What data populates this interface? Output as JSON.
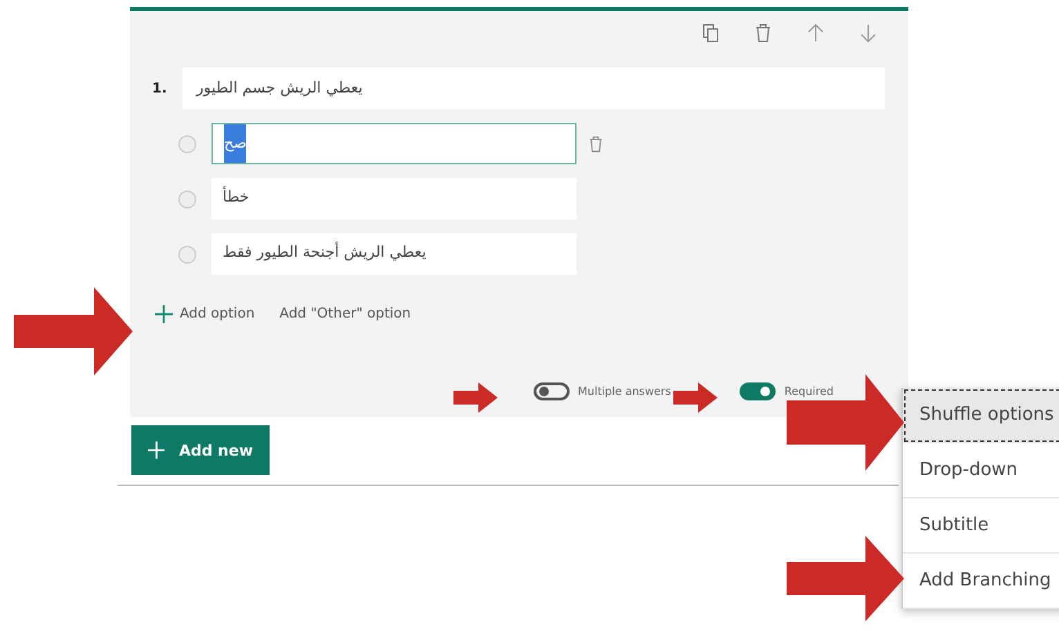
{
  "question": {
    "number": "1.",
    "text": "يعطي الريش جسم الطيور",
    "options": [
      {
        "text": "صح",
        "checked": false,
        "highlighted": true,
        "focused": true
      },
      {
        "text": "خطأ",
        "checked": false,
        "highlighted": false,
        "focused": false
      },
      {
        "text": "يعطي الريش أجنحة الطيور فقط",
        "checked": false,
        "highlighted": false,
        "focused": false
      }
    ],
    "add_option": "Add option",
    "add_other": "Add \"Other\" option",
    "toggles": [
      {
        "label": "Multiple answers",
        "on": false
      },
      {
        "label": "Required",
        "on": true
      }
    ]
  },
  "add_new": "Add new",
  "menu": [
    {
      "label": "Shuffle options",
      "selected": true
    },
    {
      "label": "Drop-down",
      "selected": false
    },
    {
      "label": "Subtitle",
      "selected": false
    },
    {
      "label": "Add Branching",
      "selected": false
    }
  ]
}
